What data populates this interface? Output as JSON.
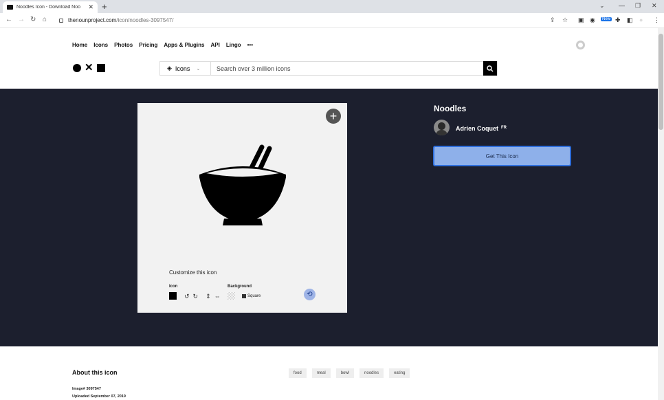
{
  "browser": {
    "tab_title": "Noodles Icon - Download Noo",
    "new_tab": "+",
    "url_domain": "thenounproject.com",
    "url_path": "/icon/noodles-3097547/",
    "new_badge": "New"
  },
  "site": {
    "nav": [
      "Home",
      "Icons",
      "Photos",
      "Pricing",
      "Apps & Plugins",
      "API",
      "Lingo",
      "•••"
    ],
    "search_type": "Icons",
    "search_placeholder": "Search over 3 million icons"
  },
  "icon": {
    "name": "Noodles",
    "author": "Adrien Coquet",
    "country": "FR",
    "get_button": "Get This Icon",
    "customize_title": "Customize this icon",
    "icon_label": "Icon",
    "background_label": "Background",
    "shape_label": "Square",
    "color": "#000000"
  },
  "about": {
    "title": "About this icon",
    "tags": [
      "food",
      "meal",
      "bowl",
      "noodles",
      "eating"
    ],
    "image_number": "Image# 3097547",
    "uploaded": "Uploaded September 07, 2019"
  }
}
